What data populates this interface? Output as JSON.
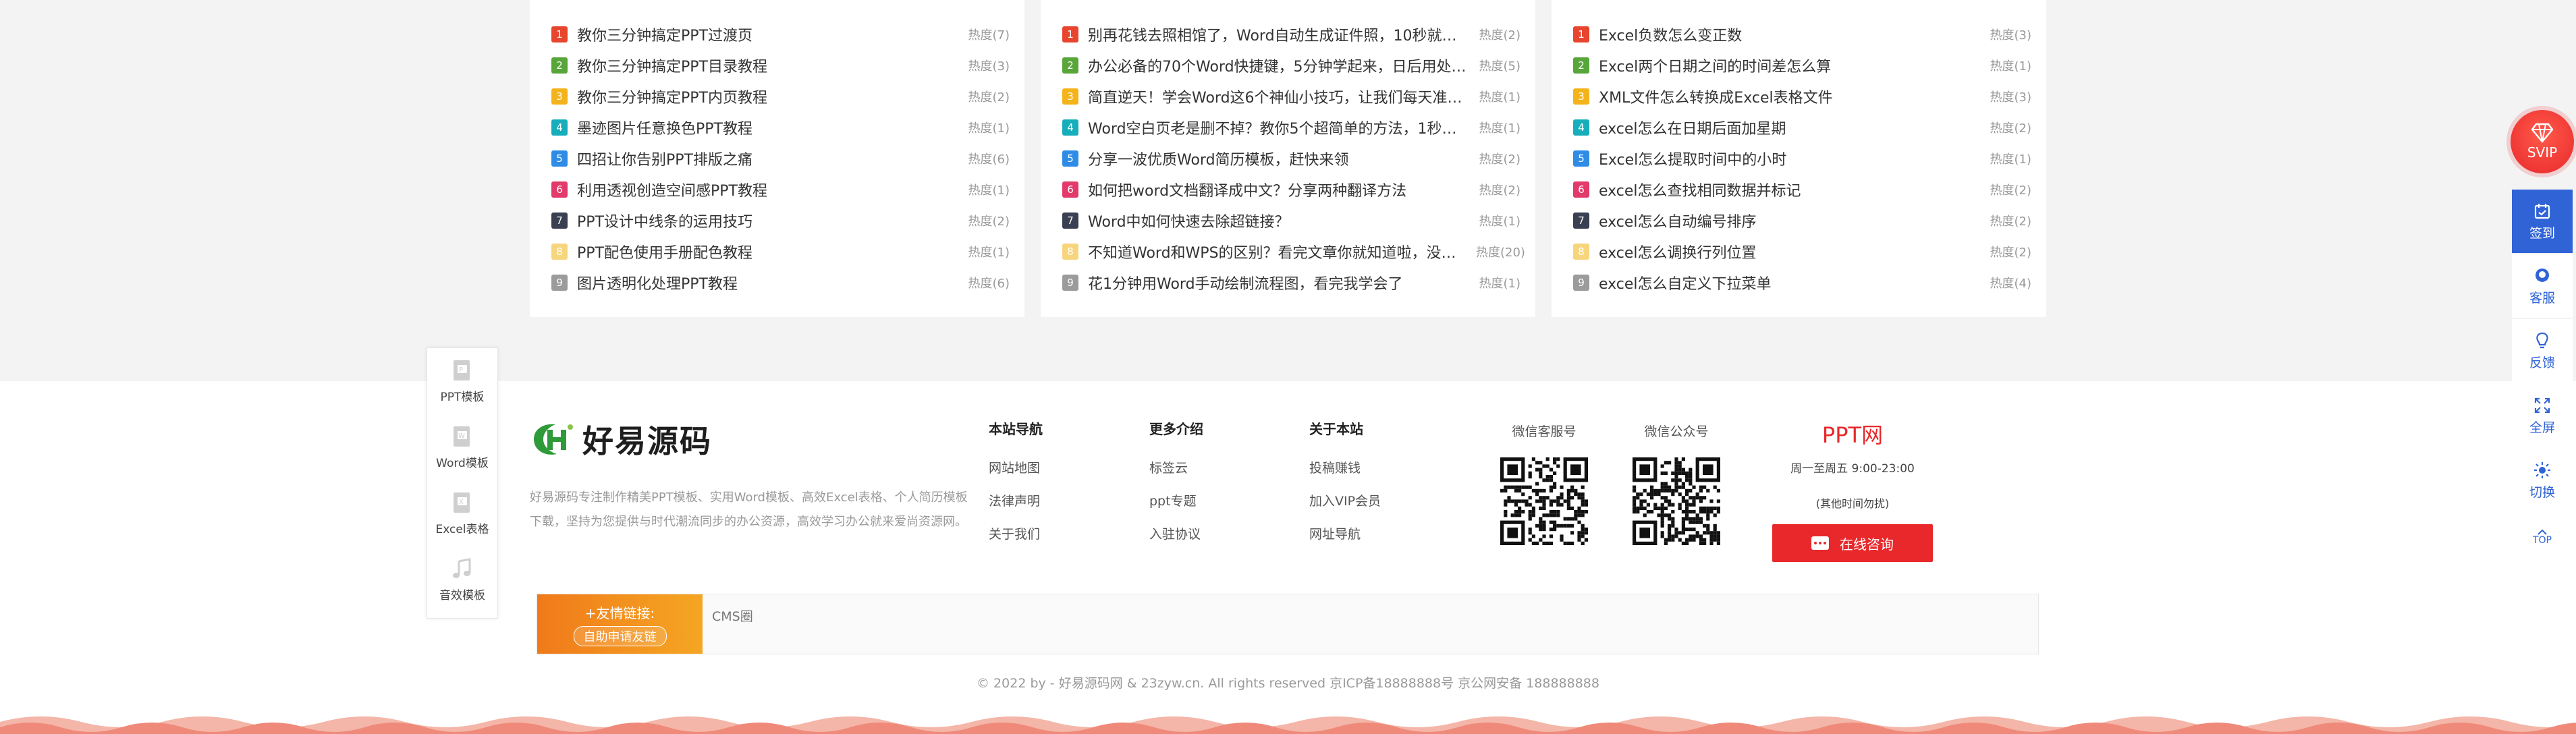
{
  "rank_lists": [
    {
      "items": [
        {
          "num": "1",
          "title": "教你三分钟搞定PPT过渡页",
          "heat": "热度(7)"
        },
        {
          "num": "2",
          "title": "教你三分钟搞定PPT目录教程",
          "heat": "热度(3)"
        },
        {
          "num": "3",
          "title": "教你三分钟搞定PPT内页教程",
          "heat": "热度(2)"
        },
        {
          "num": "4",
          "title": "墨迹图片任意换色PPT教程",
          "heat": "热度(1)"
        },
        {
          "num": "5",
          "title": "四招让你告别PPT排版之痛",
          "heat": "热度(6)"
        },
        {
          "num": "6",
          "title": "利用透视创造空间感PPT教程",
          "heat": "热度(1)"
        },
        {
          "num": "7",
          "title": "PPT设计中线条的运用技巧",
          "heat": "热度(2)"
        },
        {
          "num": "8",
          "title": "PPT配色使用手册配色教程",
          "heat": "热度(1)"
        },
        {
          "num": "9",
          "title": "图片透明化处理PPT教程",
          "heat": "热度(6)"
        }
      ]
    },
    {
      "items": [
        {
          "num": "1",
          "title": "别再花钱去照相馆了，Word自动生成证件照，10秒就…",
          "heat": "热度(2)"
        },
        {
          "num": "2",
          "title": "办公必备的70个Word快捷键，5分钟学起来，日后用处…",
          "heat": "热度(5)"
        },
        {
          "num": "3",
          "title": "简直逆天！学会Word这6个神仙小技巧，让我们每天准…",
          "heat": "热度(1)"
        },
        {
          "num": "4",
          "title": "Word空白页老是删不掉？教你5个超简单的方法，1秒…",
          "heat": "热度(1)"
        },
        {
          "num": "5",
          "title": "分享一波优质Word简历模板，赶快来领",
          "heat": "热度(2)"
        },
        {
          "num": "6",
          "title": "如何把word文档翻译成中文？分享两种翻译方法",
          "heat": "热度(2)"
        },
        {
          "num": "7",
          "title": "Word中如何快速去除超链接？",
          "heat": "热度(1)"
        },
        {
          "num": "8",
          "title": "不知道Word和WPS的区别？看完文章你就知道啦，没…",
          "heat": "热度(20)"
        },
        {
          "num": "9",
          "title": "花1分钟用Word手动绘制流程图，看完我学会了",
          "heat": "热度(1)"
        }
      ]
    },
    {
      "items": [
        {
          "num": "1",
          "title": "Excel负数怎么变正数",
          "heat": "热度(3)"
        },
        {
          "num": "2",
          "title": "Excel两个日期之间的时间差怎么算",
          "heat": "热度(1)"
        },
        {
          "num": "3",
          "title": "XML文件怎么转换成Excel表格文件",
          "heat": "热度(3)"
        },
        {
          "num": "4",
          "title": "excel怎么在日期后面加星期",
          "heat": "热度(2)"
        },
        {
          "num": "5",
          "title": "Excel怎么提取时间中的小时",
          "heat": "热度(1)"
        },
        {
          "num": "6",
          "title": "excel怎么查找相同数据并标记",
          "heat": "热度(2)"
        },
        {
          "num": "7",
          "title": "excel怎么自动编号排序",
          "heat": "热度(2)"
        },
        {
          "num": "8",
          "title": "excel怎么调换行列位置",
          "heat": "热度(2)"
        },
        {
          "num": "9",
          "title": "excel怎么自定义下拉菜单",
          "heat": "热度(4)"
        }
      ]
    }
  ],
  "categories": [
    {
      "label": "PPT模板",
      "icon": "ppt-file-icon"
    },
    {
      "label": "Word模板",
      "icon": "word-file-icon"
    },
    {
      "label": "Excel表格",
      "icon": "excel-file-icon"
    },
    {
      "label": "音效模板",
      "icon": "music-note-icon"
    }
  ],
  "footer": {
    "logo_text": "好易源码",
    "about": "好易源码专注制作精美PPT模板、实用Word模板、高效Excel表格、个人简历模板下载，坚持为您提供与时代潮流同步的办公资源，高效学习办公就来爱尚资源网。",
    "nav_columns": [
      {
        "title": "本站导航",
        "links": [
          "网站地图",
          "法律声明",
          "关于我们"
        ]
      },
      {
        "title": "更多介绍",
        "links": [
          "标签云",
          "ppt专题",
          "入驻协议"
        ]
      },
      {
        "title": "关于本站",
        "links": [
          "投稿赚钱",
          "加入VIP会员",
          "网址导航"
        ]
      }
    ],
    "qr_codes": [
      {
        "label": "微信客服号"
      },
      {
        "label": "微信公众号"
      }
    ],
    "ppt": {
      "title": "PPT网",
      "hours": "周一至周五 9:00-23:00",
      "note": "(其他时间勿扰)",
      "consult_label": "在线咨询"
    },
    "friend_links": {
      "title": "+友情链接:",
      "apply_label": "自助申请友链",
      "links": [
        "CMS圈"
      ]
    },
    "copyright": "© 2022 by - 好易源码网 & 23zyw.cn. All rights reserved   京ICP备18888888号   京公网安备 188888888"
  },
  "sidebar": {
    "svip_label": "SVIP",
    "items": [
      {
        "label": "签到",
        "icon": "calendar-check-icon"
      },
      {
        "label": "客服",
        "icon": "headset-icon"
      },
      {
        "label": "反馈",
        "icon": "lightbulb-icon"
      },
      {
        "label": "全屏",
        "icon": "fullscreen-icon"
      },
      {
        "label": "切换",
        "icon": "sun-icon"
      }
    ],
    "top_label": "TOP"
  },
  "colors": {
    "accent_red": "#e8282b",
    "accent_blue": "#2f63d6",
    "friend_orange": "#f07a1a"
  }
}
